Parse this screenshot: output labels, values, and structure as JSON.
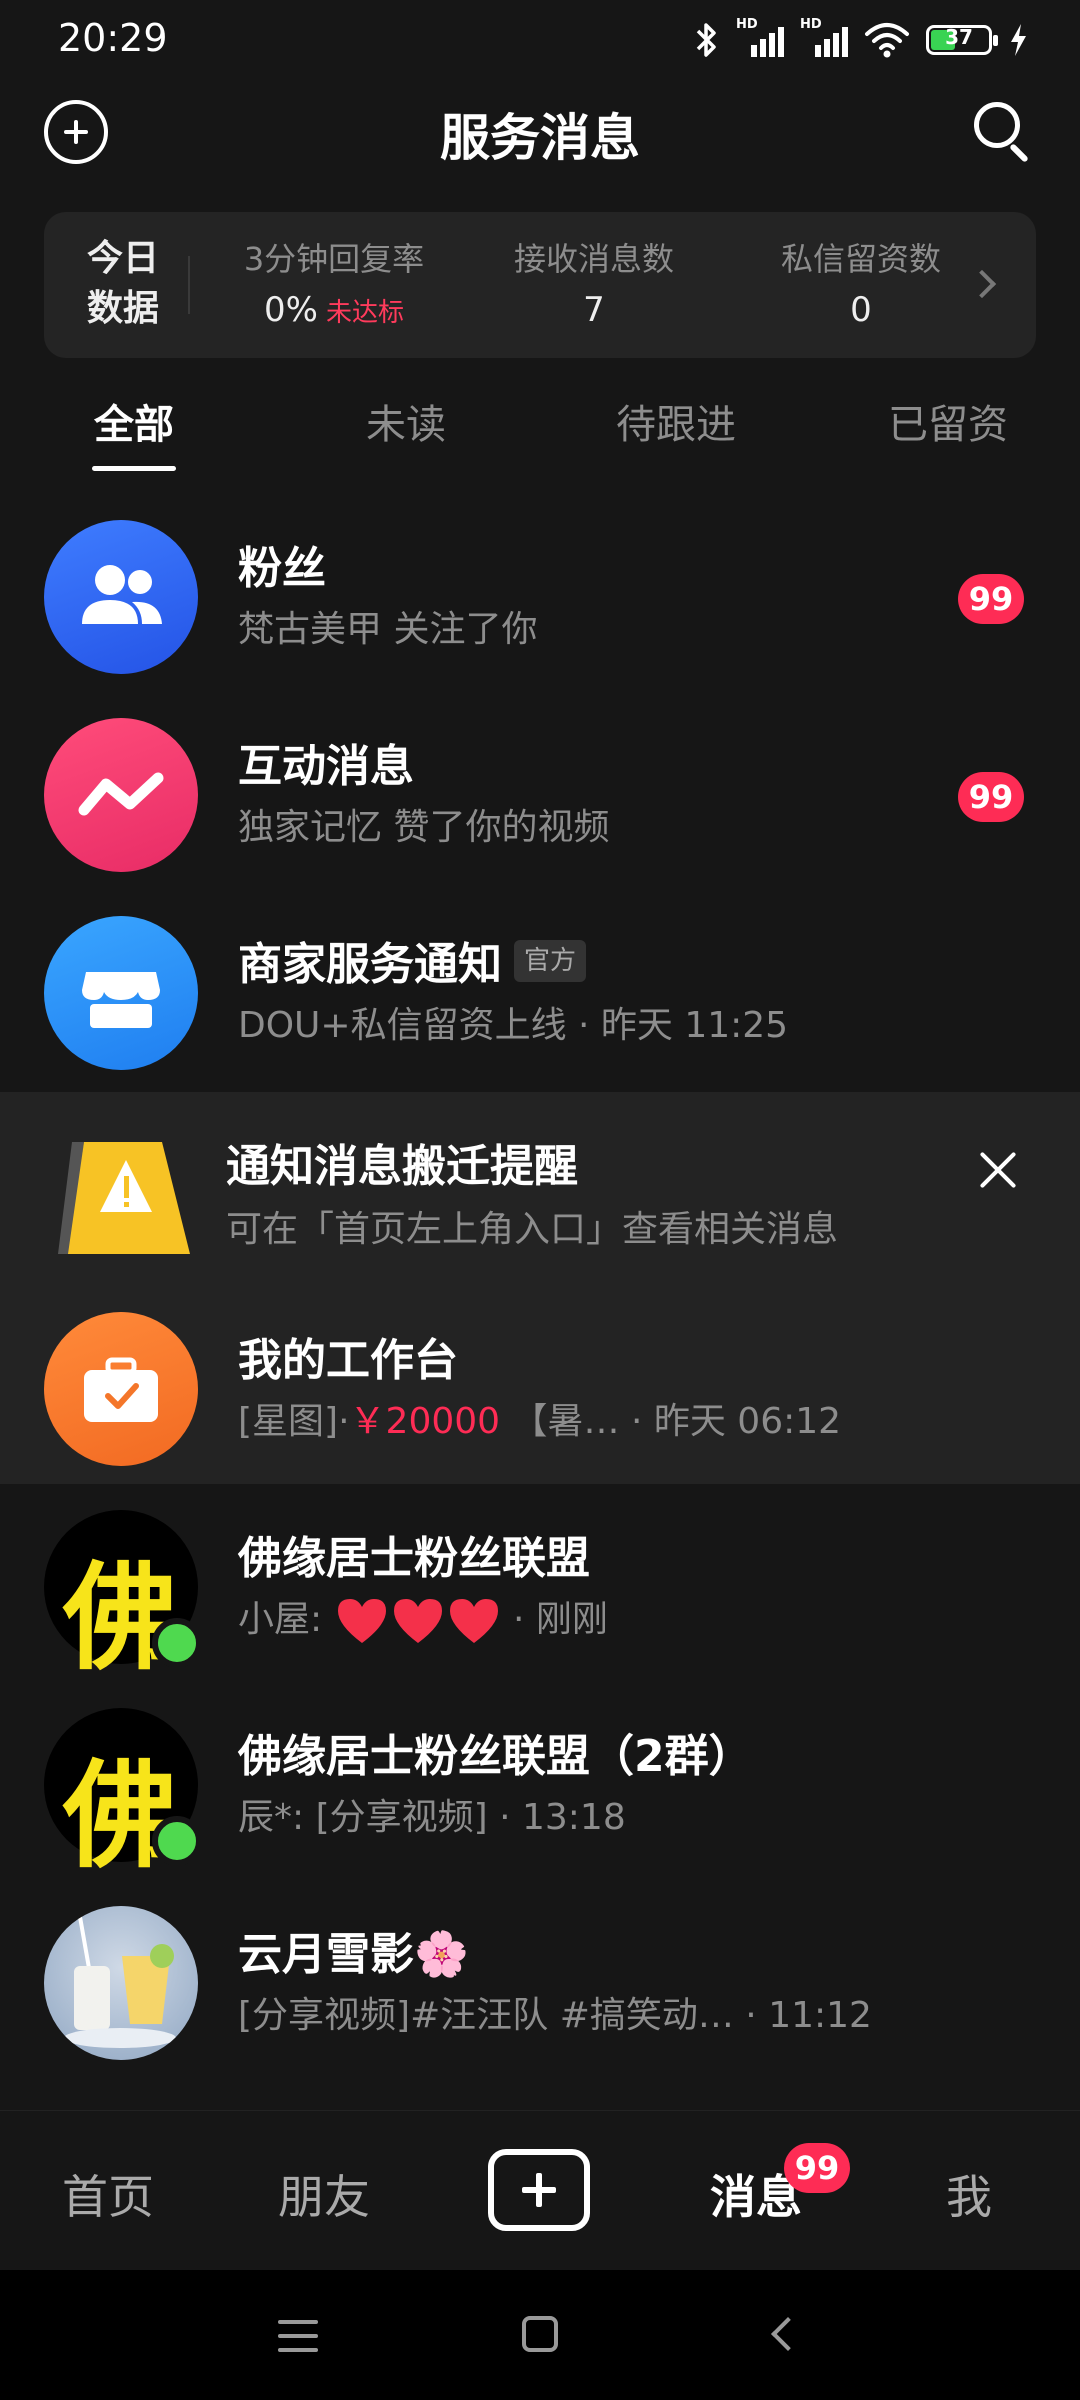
{
  "status_bar": {
    "time": "20:29",
    "network_label_1": "HD",
    "network_label_2": "HD",
    "battery_level": "37",
    "icons": [
      "bluetooth-icon",
      "signal-icon",
      "signal-icon",
      "wifi-icon",
      "battery-icon",
      "charging-icon"
    ]
  },
  "header": {
    "title": "服务消息",
    "left_icon": "plus-circle-icon",
    "right_icon": "search-icon"
  },
  "stats": {
    "label": "今日数据",
    "items": [
      {
        "label": "3分钟回复率",
        "value": "0%",
        "status": "未达标"
      },
      {
        "label": "接收消息数",
        "value": "7"
      },
      {
        "label": "私信留资数",
        "value": "0"
      }
    ]
  },
  "tabs": [
    {
      "label": "全部",
      "active": true
    },
    {
      "label": "未读"
    },
    {
      "label": "待跟进"
    },
    {
      "label": "已留资"
    }
  ],
  "conversations": [
    {
      "title": "粉丝",
      "subtitle": "梵古美甲 关注了你",
      "badge": "99",
      "icon": "people-icon",
      "color": "#2f63f6"
    },
    {
      "title": "互动消息",
      "subtitle": "独家记忆 赞了你的视频",
      "badge": "99",
      "icon": "zigzag-icon",
      "color": "#f2386f"
    },
    {
      "title": "商家服务通知",
      "tag": "官方",
      "subtitle": "DOU+私信留资上线 · 昨天 11:25",
      "icon": "shop-icon",
      "color": "#2c8ff7"
    },
    {
      "title": "我的工作台",
      "subtitle_prefix": "[星图]·",
      "subtitle_price": "￥20000",
      "subtitle_suffix": "【暑…   · 昨天 06:12",
      "icon": "briefcase-icon",
      "color": "#f4762a"
    },
    {
      "title": "佛缘居士粉丝联盟",
      "subtitle_prefix": "小屋:",
      "subtitle_suffix": "· 刚刚",
      "hearts": 3,
      "avatar_char": "佛",
      "online": true
    },
    {
      "title": "佛缘居士粉丝联盟（2群）",
      "subtitle": "辰*: [分享视频] · 13:18",
      "avatar_char": "佛",
      "online": true
    },
    {
      "title": "云月雪影🌸",
      "subtitle": "[分享视频]#汪汪队 #搞笑动…  · 11:12",
      "icon": "drink-photo-icon"
    }
  ],
  "notice": {
    "title": "通知消息搬迁提醒",
    "subtitle": "可在「首页左上角入口」查看相关消息",
    "icon": "warning-sign-icon",
    "accent": "#f7c325"
  },
  "bottom_nav": {
    "items": [
      "首页",
      "朋友",
      "消息",
      "我"
    ],
    "active": "消息",
    "badge": "99"
  }
}
